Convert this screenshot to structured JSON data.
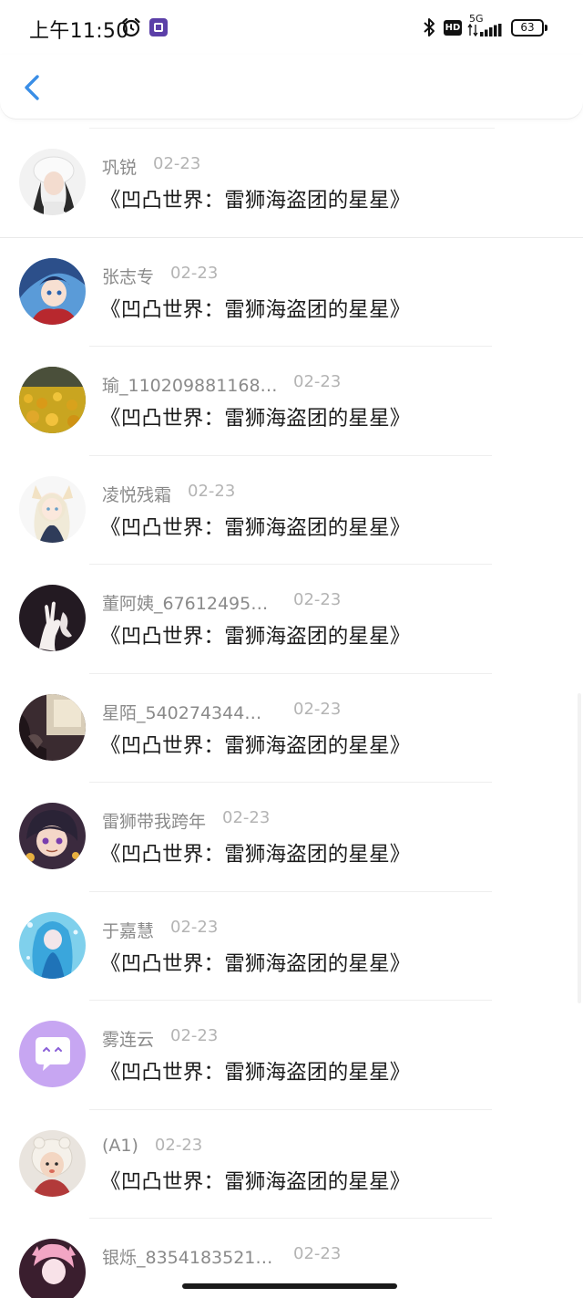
{
  "status_bar": {
    "time": "上午11:50",
    "hd": "HD",
    "network": "5G",
    "battery": "63"
  },
  "header": {
    "back_icon": "chevron-left-icon",
    "accent": "#3a8ee6"
  },
  "items": [
    {
      "name": "巩锐",
      "date": "02-23",
      "content": "《凹凸世界：雷狮海盗团的星星》",
      "avatar": "girl-white-hat"
    },
    {
      "name": "张志专",
      "date": "02-23",
      "content": "《凹凸世界：雷狮海盗团的星星》",
      "avatar": "anime-blue-hair"
    },
    {
      "name": "瑜_110209881168…",
      "date": "02-23",
      "content": "《凹凸世界：雷狮海盗团的星星》",
      "avatar": "flower-field"
    },
    {
      "name": "凌悦残霜",
      "date": "02-23",
      "content": "《凹凸世界：雷狮海盗团的星星》",
      "avatar": "anime-white-fox"
    },
    {
      "name": "董阿姨_67612495…",
      "date": "02-23",
      "content": "《凹凸世界：雷狮海盗团的星星》",
      "avatar": "hands-dark"
    },
    {
      "name": "星陌_540274344…",
      "date": "02-23",
      "content": "《凹凸世界：雷狮海盗团的星星》",
      "avatar": "dim-photo"
    },
    {
      "name": "雷狮带我跨年",
      "date": "02-23",
      "content": "《凹凸世界：雷狮海盗团的星星》",
      "avatar": "anime-purple-boy"
    },
    {
      "name": "于嘉慧",
      "date": "02-23",
      "content": "《凹凸世界：雷狮海盗团的星星》",
      "avatar": "anime-blue-mermaid"
    },
    {
      "name": "雾连云",
      "date": "02-23",
      "content": "《凹凸世界：雷狮海盗团的星星》",
      "avatar": "default-chat-bubble"
    },
    {
      "name": "(A1)",
      "date": "02-23",
      "content": "《凹凸世界：雷狮海盗团的星星》",
      "avatar": "child-photo"
    },
    {
      "name": "银烁_8354183521…",
      "date": "02-23",
      "content": "",
      "avatar": "anime-pink"
    }
  ]
}
